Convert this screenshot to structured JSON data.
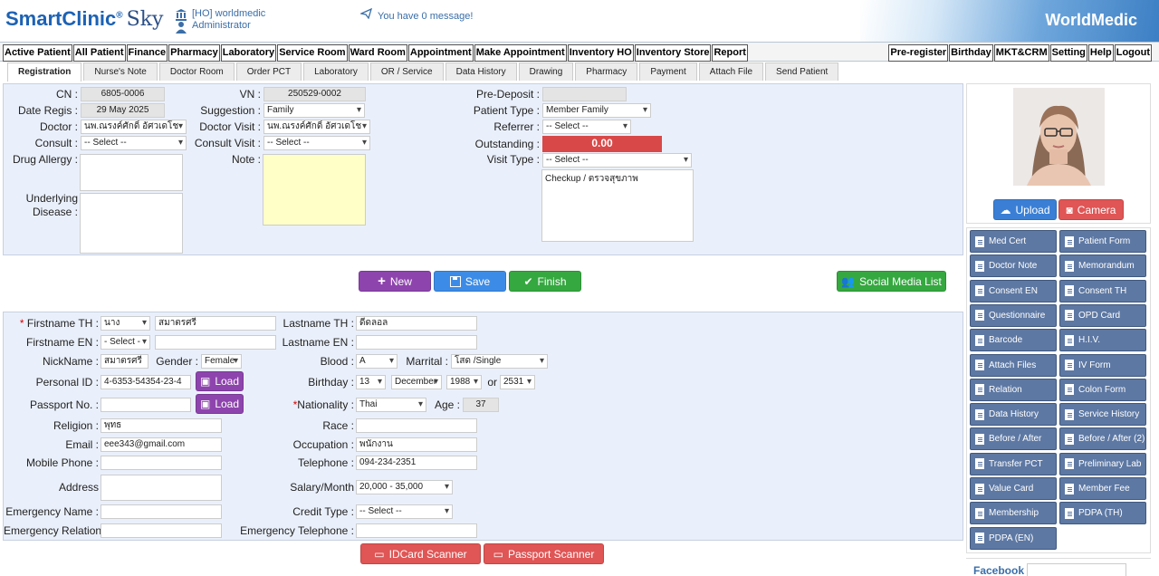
{
  "header": {
    "logo": "SmartClinic",
    "logo_reg": "®",
    "logo_sky": "Sky",
    "org": "[HO] worldmedic",
    "user": "Administrator",
    "message": "You have 0 message!",
    "brand": "WorldMedic"
  },
  "menu_left": [
    "Active Patient",
    "All Patient",
    "Finance",
    "Pharmacy",
    "Laboratory",
    "Service Room",
    "Ward Room",
    "Appointment",
    "Make Appointment",
    "Inventory HO",
    "Inventory Store",
    "Report"
  ],
  "menu_right": [
    "Pre-register",
    "Birthday",
    "MKT&CRM",
    "Setting",
    "Help",
    "Logout"
  ],
  "tabs": [
    "Registration",
    "Nurse's Note",
    "Doctor Room",
    "Order PCT",
    "Laboratory",
    "OR / Service",
    "Data History",
    "Drawing",
    "Pharmacy",
    "Payment",
    "Attach File",
    "Send Patient"
  ],
  "visit": {
    "cn_label": "CN :",
    "cn": "6805-0006",
    "date_label": "Date Regis :",
    "date": "29 May 2025",
    "doctor_label": "Doctor :",
    "doctor": "นพ.ณรงค์ศักดิ์ อัศวเดโช",
    "consult_label": "Consult :",
    "consult": "-- Select --",
    "allergy_label": "Drug Allergy :",
    "underlying_label": "Underlying",
    "disease_label": "Disease :",
    "vn_label": "VN :",
    "vn": "250529-0002",
    "suggestion_label": "Suggestion :",
    "suggestion": "Family",
    "doctor_visit_label": "Doctor Visit :",
    "doctor_visit": "นพ.ณรงค์ศักดิ์ อัศวเดโช",
    "consult_visit_label": "Consult Visit :",
    "consult_visit": "-- Select --",
    "note_label": "Note :",
    "predeposit_label": "Pre-Deposit :",
    "patient_type_label": "Patient Type :",
    "patient_type": "Member Family",
    "referrer_label": "Referrer :",
    "referrer": "-- Select --",
    "outstanding_label": "Outstanding :",
    "outstanding": "0.00",
    "visit_type_label": "Visit Type :",
    "visit_type": "-- Select --",
    "visit_note": "Checkup / ตรวจสุขภาพ"
  },
  "actions": {
    "new": "New",
    "save": "Save",
    "finish": "Finish",
    "social": "Social Media List"
  },
  "patient": {
    "firstname_th_label": "Firstname TH :",
    "prefix_th": "นาง",
    "firstname_th": "สมาตรศรี",
    "lastname_th_label": "Lastname TH :",
    "lastname_th": "ดีดลอล",
    "firstname_en_label": "Firstname EN :",
    "prefix_en": "- Select -",
    "lastname_en_label": "Lastname EN :",
    "nickname_label": "NickName :",
    "nickname": "สมาตรศรี",
    "gender_label": "Gender :",
    "gender": "Female",
    "blood_label": "Blood :",
    "blood": "A",
    "marital_label": "Marrital :",
    "marital": "โสด /Single",
    "pid_label": "Personal ID :",
    "pid": "4-6353-54354-23-4",
    "load": "Load",
    "birthday_label": "Birthday :",
    "bday": "13",
    "bmonth": "December",
    "byear": "1988",
    "or": "or",
    "byear_th": "2531",
    "passport_label": "Passport No. :",
    "nationality_label": "Nationality :",
    "nationality": "Thai",
    "age_label": "Age :",
    "age": "37",
    "religion_label": "Religion :",
    "religion": "พุทธ",
    "race_label": "Race :",
    "email_label": "Email :",
    "email": "eee343@gmail.com",
    "occupation_label": "Occupation :",
    "occupation": "พนักงาน",
    "mobile_label": "Mobile Phone :",
    "telephone_label": "Telephone :",
    "telephone": "094-234-2351",
    "address_label": "Address",
    "salary_label": "Salary/Month",
    "salary": "20,000 - 35,000",
    "emergency_name_label": "Emergency Name :",
    "credit_label": "Credit Type :",
    "credit": "-- Select --",
    "emergency_relation_label": "Emergency Relation :",
    "emergency_tel_label": "Emergency Telephone :"
  },
  "scanners": {
    "idcard": "IDCard Scanner",
    "passport": "Passport Scanner"
  },
  "photo": {
    "upload": "Upload",
    "camera": "Camera"
  },
  "side_buttons": [
    "Med Cert",
    "Patient Form",
    "Doctor Note",
    "Memorandum",
    "Consent EN",
    "Consent TH",
    "Questionnaire",
    "OPD Card",
    "Barcode",
    "H.I.V.",
    "Attach Files",
    "IV Form",
    "Relation",
    "Colon Form",
    "Data History",
    "Service History",
    "Before / After",
    "Before / After (2)",
    "Transfer PCT",
    "Preliminary Lab",
    "Value Card",
    "Member Fee",
    "Membership",
    "PDPA (TH)",
    "PDPA (EN)"
  ],
  "facebook_label": "Facebook :"
}
